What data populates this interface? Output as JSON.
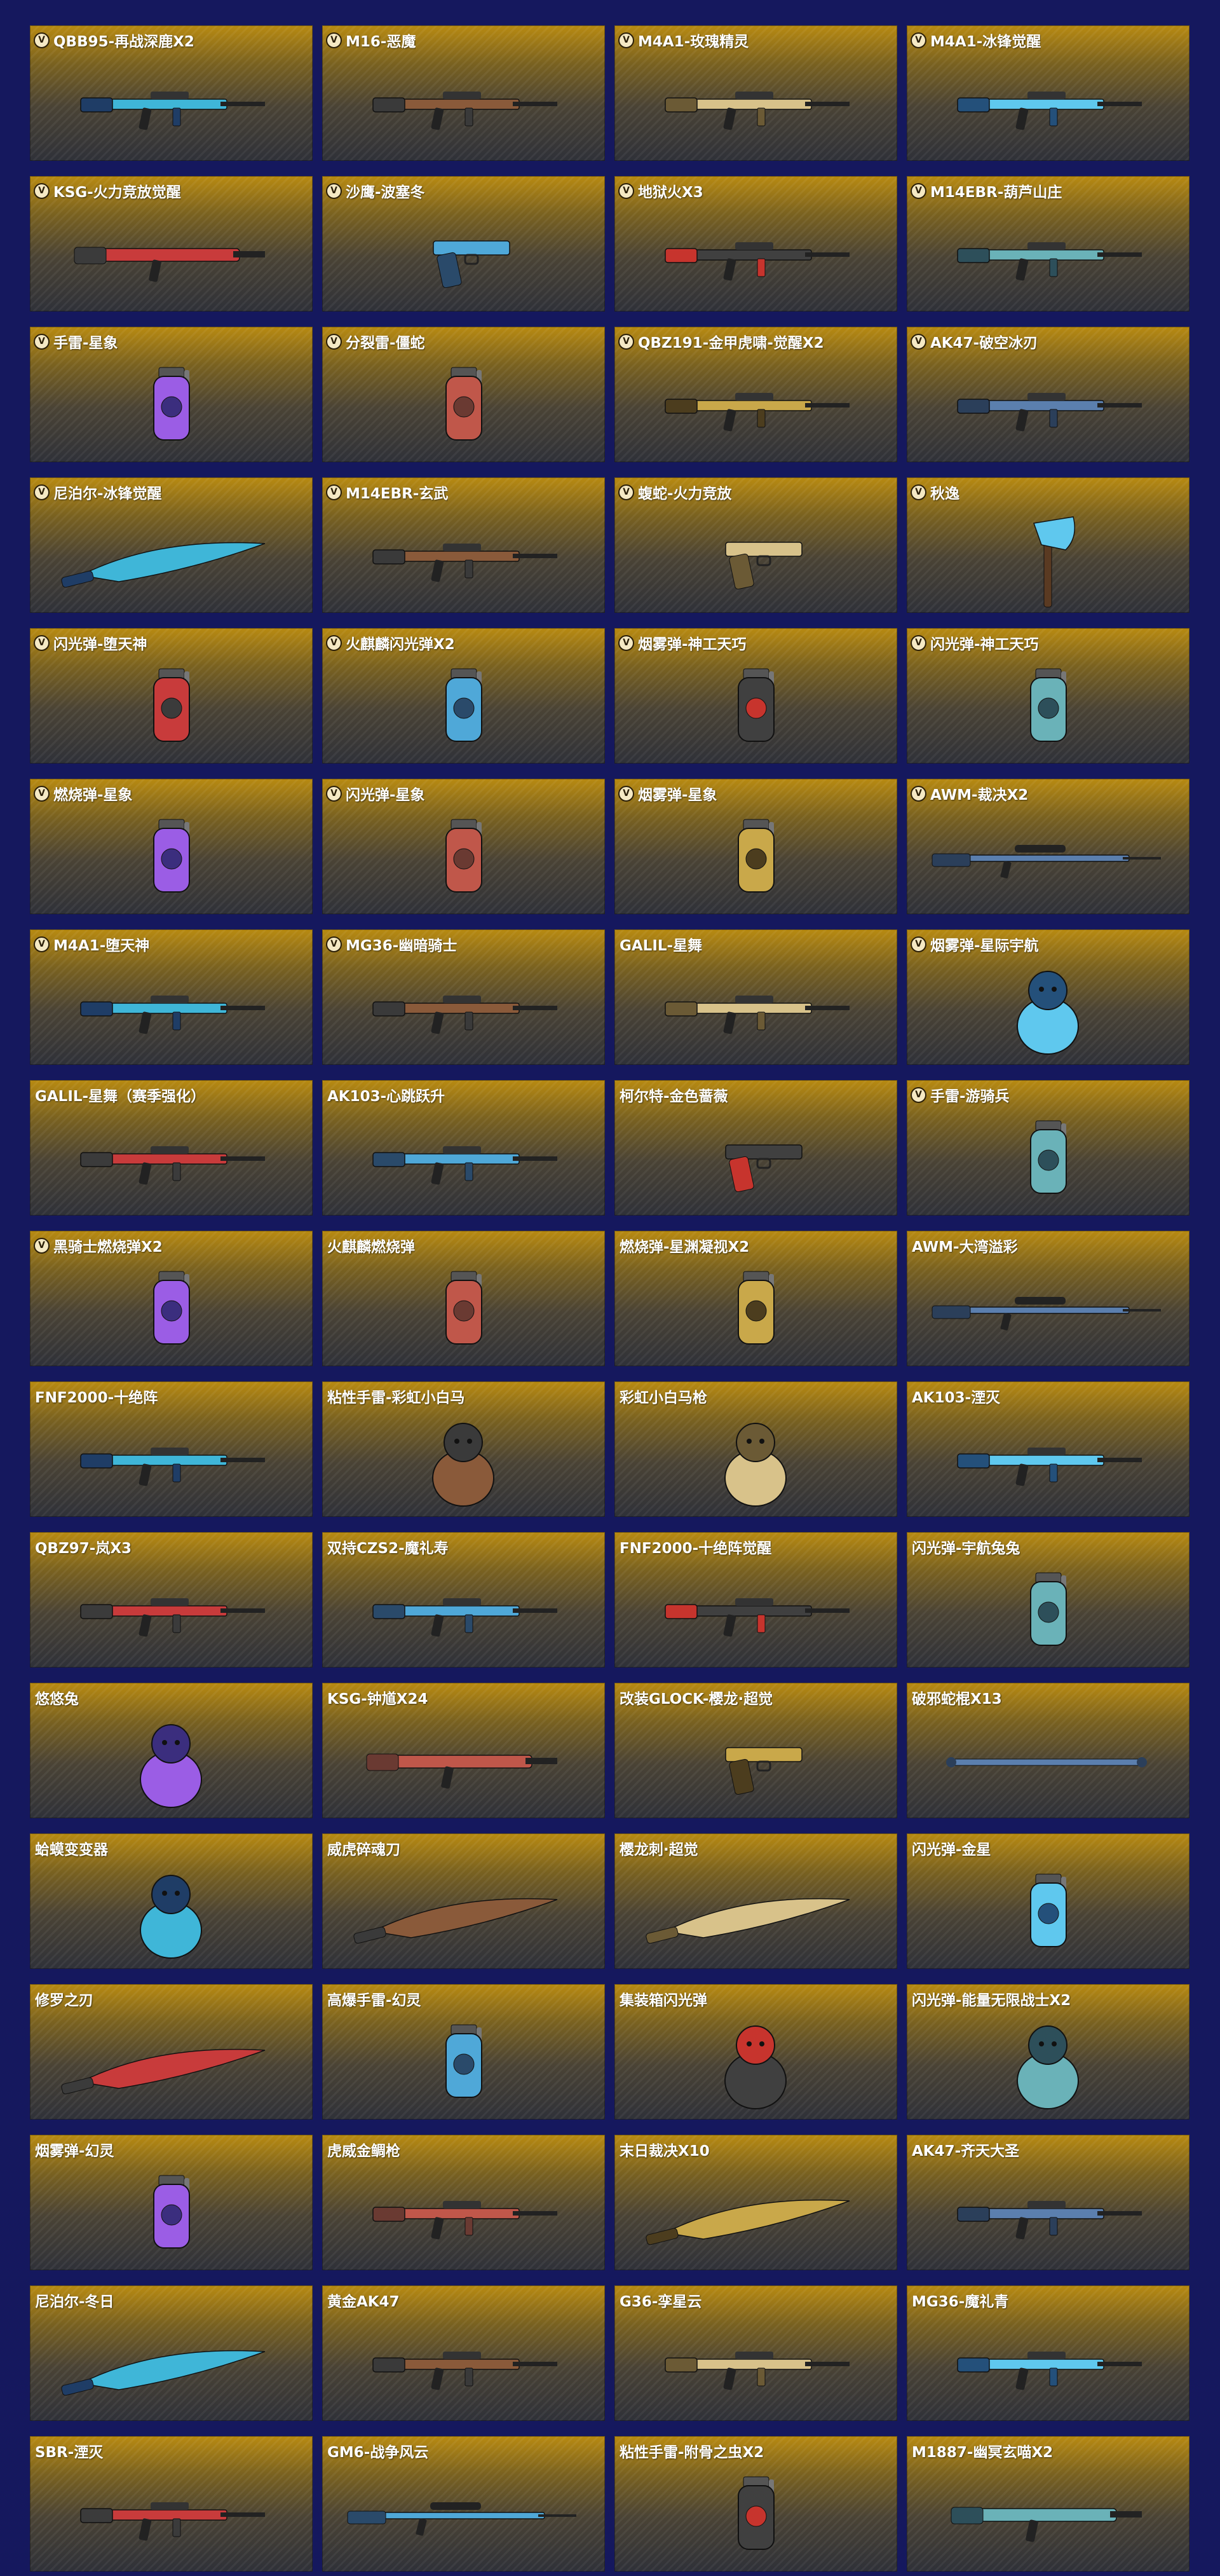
{
  "items": [
    {
      "name": "QBB95-再战深鹿X2",
      "vip": true,
      "icon": "rifle-icon"
    },
    {
      "name": "M16-恶魔",
      "vip": true,
      "icon": "rifle-icon"
    },
    {
      "name": "M4A1-玫瑰精灵",
      "vip": true,
      "icon": "rifle-icon"
    },
    {
      "name": "M4A1-冰锋觉醒",
      "vip": true,
      "icon": "rifle-icon"
    },
    {
      "name": "KSG-火力竞放觉醒",
      "vip": true,
      "icon": "shotgun-icon"
    },
    {
      "name": "沙鹰-波塞冬",
      "vip": true,
      "icon": "pistol-icon"
    },
    {
      "name": "地狱火X3",
      "vip": true,
      "icon": "rifle-icon"
    },
    {
      "name": "M14EBR-葫芦山庄",
      "vip": true,
      "icon": "rifle-icon"
    },
    {
      "name": "手雷-星象",
      "vip": true,
      "icon": "grenade-icon"
    },
    {
      "name": "分裂雷-僵蛇",
      "vip": true,
      "icon": "grenade-icon"
    },
    {
      "name": "QBZ191-金甲虎啸-觉醒X2",
      "vip": true,
      "icon": "rifle-icon"
    },
    {
      "name": "AK47-破空冰刃",
      "vip": true,
      "icon": "rifle-icon"
    },
    {
      "name": "尼泊尔-冰锋觉醒",
      "vip": true,
      "icon": "knife-icon"
    },
    {
      "name": "M14EBR-玄武",
      "vip": true,
      "icon": "rifle-icon"
    },
    {
      "name": "蝮蛇-火力竞放",
      "vip": true,
      "icon": "pistol-icon"
    },
    {
      "name": "秋逸",
      "vip": true,
      "icon": "axe-icon"
    },
    {
      "name": "闪光弹-堕天神",
      "vip": true,
      "icon": "grenade-icon"
    },
    {
      "name": "火麒麟闪光弹X2",
      "vip": true,
      "icon": "grenade-icon"
    },
    {
      "name": "烟雾弹-神工天巧",
      "vip": true,
      "icon": "grenade-icon"
    },
    {
      "name": "闪光弹-神工天巧",
      "vip": true,
      "icon": "grenade-icon"
    },
    {
      "name": "燃烧弹-星象",
      "vip": true,
      "icon": "grenade-icon"
    },
    {
      "name": "闪光弹-星象",
      "vip": true,
      "icon": "grenade-icon"
    },
    {
      "name": "烟雾弹-星象",
      "vip": true,
      "icon": "grenade-icon"
    },
    {
      "name": "AWM-裁决X2",
      "vip": true,
      "icon": "sniper-icon"
    },
    {
      "name": "M4A1-堕天神",
      "vip": true,
      "icon": "rifle-icon"
    },
    {
      "name": "MG36-幽暗骑士",
      "vip": true,
      "icon": "rifle-icon"
    },
    {
      "name": "GALIL-星舞",
      "vip": false,
      "icon": "rifle-icon"
    },
    {
      "name": "烟雾弹-星际宇航",
      "vip": true,
      "icon": "figure-icon"
    },
    {
      "name": "GALIL-星舞（赛季强化）",
      "vip": false,
      "icon": "rifle-icon"
    },
    {
      "name": "AK103-心跳跃升",
      "vip": false,
      "icon": "rifle-icon"
    },
    {
      "name": "柯尔特-金色蔷薇",
      "vip": false,
      "icon": "pistol-icon"
    },
    {
      "name": "手雷-游骑兵",
      "vip": true,
      "icon": "grenade-icon"
    },
    {
      "name": "黑骑士燃烧弹X2",
      "vip": true,
      "icon": "grenade-icon"
    },
    {
      "name": "火麒麟燃烧弹",
      "vip": false,
      "icon": "grenade-icon"
    },
    {
      "name": "燃烧弹-星渊凝视X2",
      "vip": false,
      "icon": "grenade-icon"
    },
    {
      "name": "AWM-大湾溢彩",
      "vip": false,
      "icon": "sniper-icon"
    },
    {
      "name": "FNF2000-十绝阵",
      "vip": false,
      "icon": "rifle-icon"
    },
    {
      "name": "粘性手雷-彩虹小白马",
      "vip": false,
      "icon": "figure-icon"
    },
    {
      "name": "彩虹小白马枪",
      "vip": false,
      "icon": "figure-icon"
    },
    {
      "name": "AK103-湮灭",
      "vip": false,
      "icon": "rifle-icon"
    },
    {
      "name": "QBZ97-岚X3",
      "vip": false,
      "icon": "rifle-icon"
    },
    {
      "name": "双持CZS2-魔礼寿",
      "vip": false,
      "icon": "rifle-icon"
    },
    {
      "name": "FNF2000-十绝阵觉醒",
      "vip": false,
      "icon": "rifle-icon"
    },
    {
      "name": "闪光弹-宇航兔兔",
      "vip": false,
      "icon": "grenade-icon"
    },
    {
      "name": "悠悠兔",
      "vip": false,
      "icon": "figure-icon"
    },
    {
      "name": "KSG-钟馗X24",
      "vip": false,
      "icon": "shotgun-icon"
    },
    {
      "name": "改装GLOCK-樱龙·超觉",
      "vip": false,
      "icon": "pistol-icon"
    },
    {
      "name": "破邪蛇棍X13",
      "vip": false,
      "icon": "staff-icon"
    },
    {
      "name": "蛤蟆变变器",
      "vip": false,
      "icon": "figure-icon"
    },
    {
      "name": "威虎碎魂刀",
      "vip": false,
      "icon": "knife-icon"
    },
    {
      "name": "樱龙刺·超觉",
      "vip": false,
      "icon": "knife-icon"
    },
    {
      "name": "闪光弹-金星",
      "vip": false,
      "icon": "grenade-icon"
    },
    {
      "name": "修罗之刃",
      "vip": false,
      "icon": "knife-icon"
    },
    {
      "name": "高爆手雷-幻灵",
      "vip": false,
      "icon": "grenade-icon"
    },
    {
      "name": "集装箱闪光弹",
      "vip": false,
      "icon": "figure-icon"
    },
    {
      "name": "闪光弹-能量无限战士X2",
      "vip": false,
      "icon": "figure-icon"
    },
    {
      "name": "烟雾弹-幻灵",
      "vip": false,
      "icon": "grenade-icon"
    },
    {
      "name": "虎威金鲷枪",
      "vip": false,
      "icon": "rifle-icon"
    },
    {
      "name": "末日裁决X10",
      "vip": false,
      "icon": "knife-icon"
    },
    {
      "name": "AK47-齐天大圣",
      "vip": false,
      "icon": "rifle-icon"
    },
    {
      "name": "尼泊尔-冬日",
      "vip": false,
      "icon": "knife-icon"
    },
    {
      "name": "黄金AK47",
      "vip": false,
      "icon": "rifle-icon"
    },
    {
      "name": "G36-孪星云",
      "vip": false,
      "icon": "rifle-icon"
    },
    {
      "name": "MG36-魔礼青",
      "vip": false,
      "icon": "rifle-icon"
    },
    {
      "name": "SBR-湮灭",
      "vip": false,
      "icon": "rifle-icon"
    },
    {
      "name": "GM6-战争风云",
      "vip": false,
      "icon": "sniper-icon"
    },
    {
      "name": "粘性手雷-附骨之虫X2",
      "vip": false,
      "icon": "grenade-icon"
    },
    {
      "name": "M1887-幽冥玄喵X2",
      "vip": false,
      "icon": "shotgun-icon"
    }
  ],
  "vip_badge_letter": "V",
  "colors": {
    "page_background": "#15185e",
    "card_gold": "#b88a11",
    "card_dark": "#2f3138",
    "label_text": "#ffffff"
  }
}
